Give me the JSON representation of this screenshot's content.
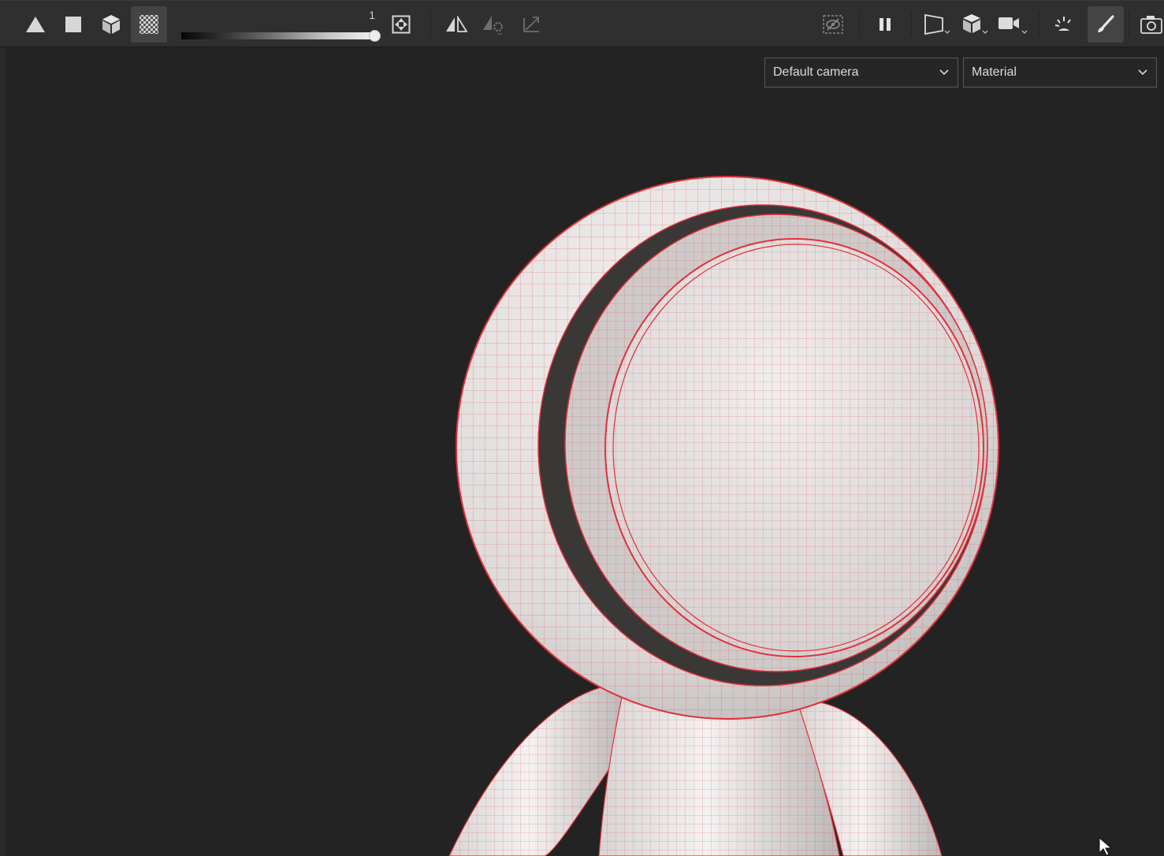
{
  "toolbar": {
    "left_tools": [
      {
        "name": "triangle-icon"
      },
      {
        "name": "square-icon"
      },
      {
        "name": "cube-icon"
      },
      {
        "name": "checker-icon",
        "active": true
      }
    ],
    "opacity_slider": {
      "value": "1",
      "level": 1.0
    },
    "right_tools": [
      {
        "name": "hide-icon"
      },
      {
        "name": "pause-icon"
      },
      {
        "name": "perspective-icon"
      },
      {
        "name": "shading-cube-icon"
      },
      {
        "name": "camera-icon"
      },
      {
        "name": "light-icon"
      },
      {
        "name": "brush-icon",
        "active": true
      },
      {
        "name": "screenshot-icon"
      }
    ]
  },
  "viewport": {
    "camera_select": {
      "selected": "Default camera"
    },
    "mode_select": {
      "selected": "Material"
    }
  },
  "colors": {
    "background": "#232323",
    "toolbar": "#2f2f2f",
    "wireframe": "#e0303a",
    "mesh": "#e6e2e2"
  }
}
